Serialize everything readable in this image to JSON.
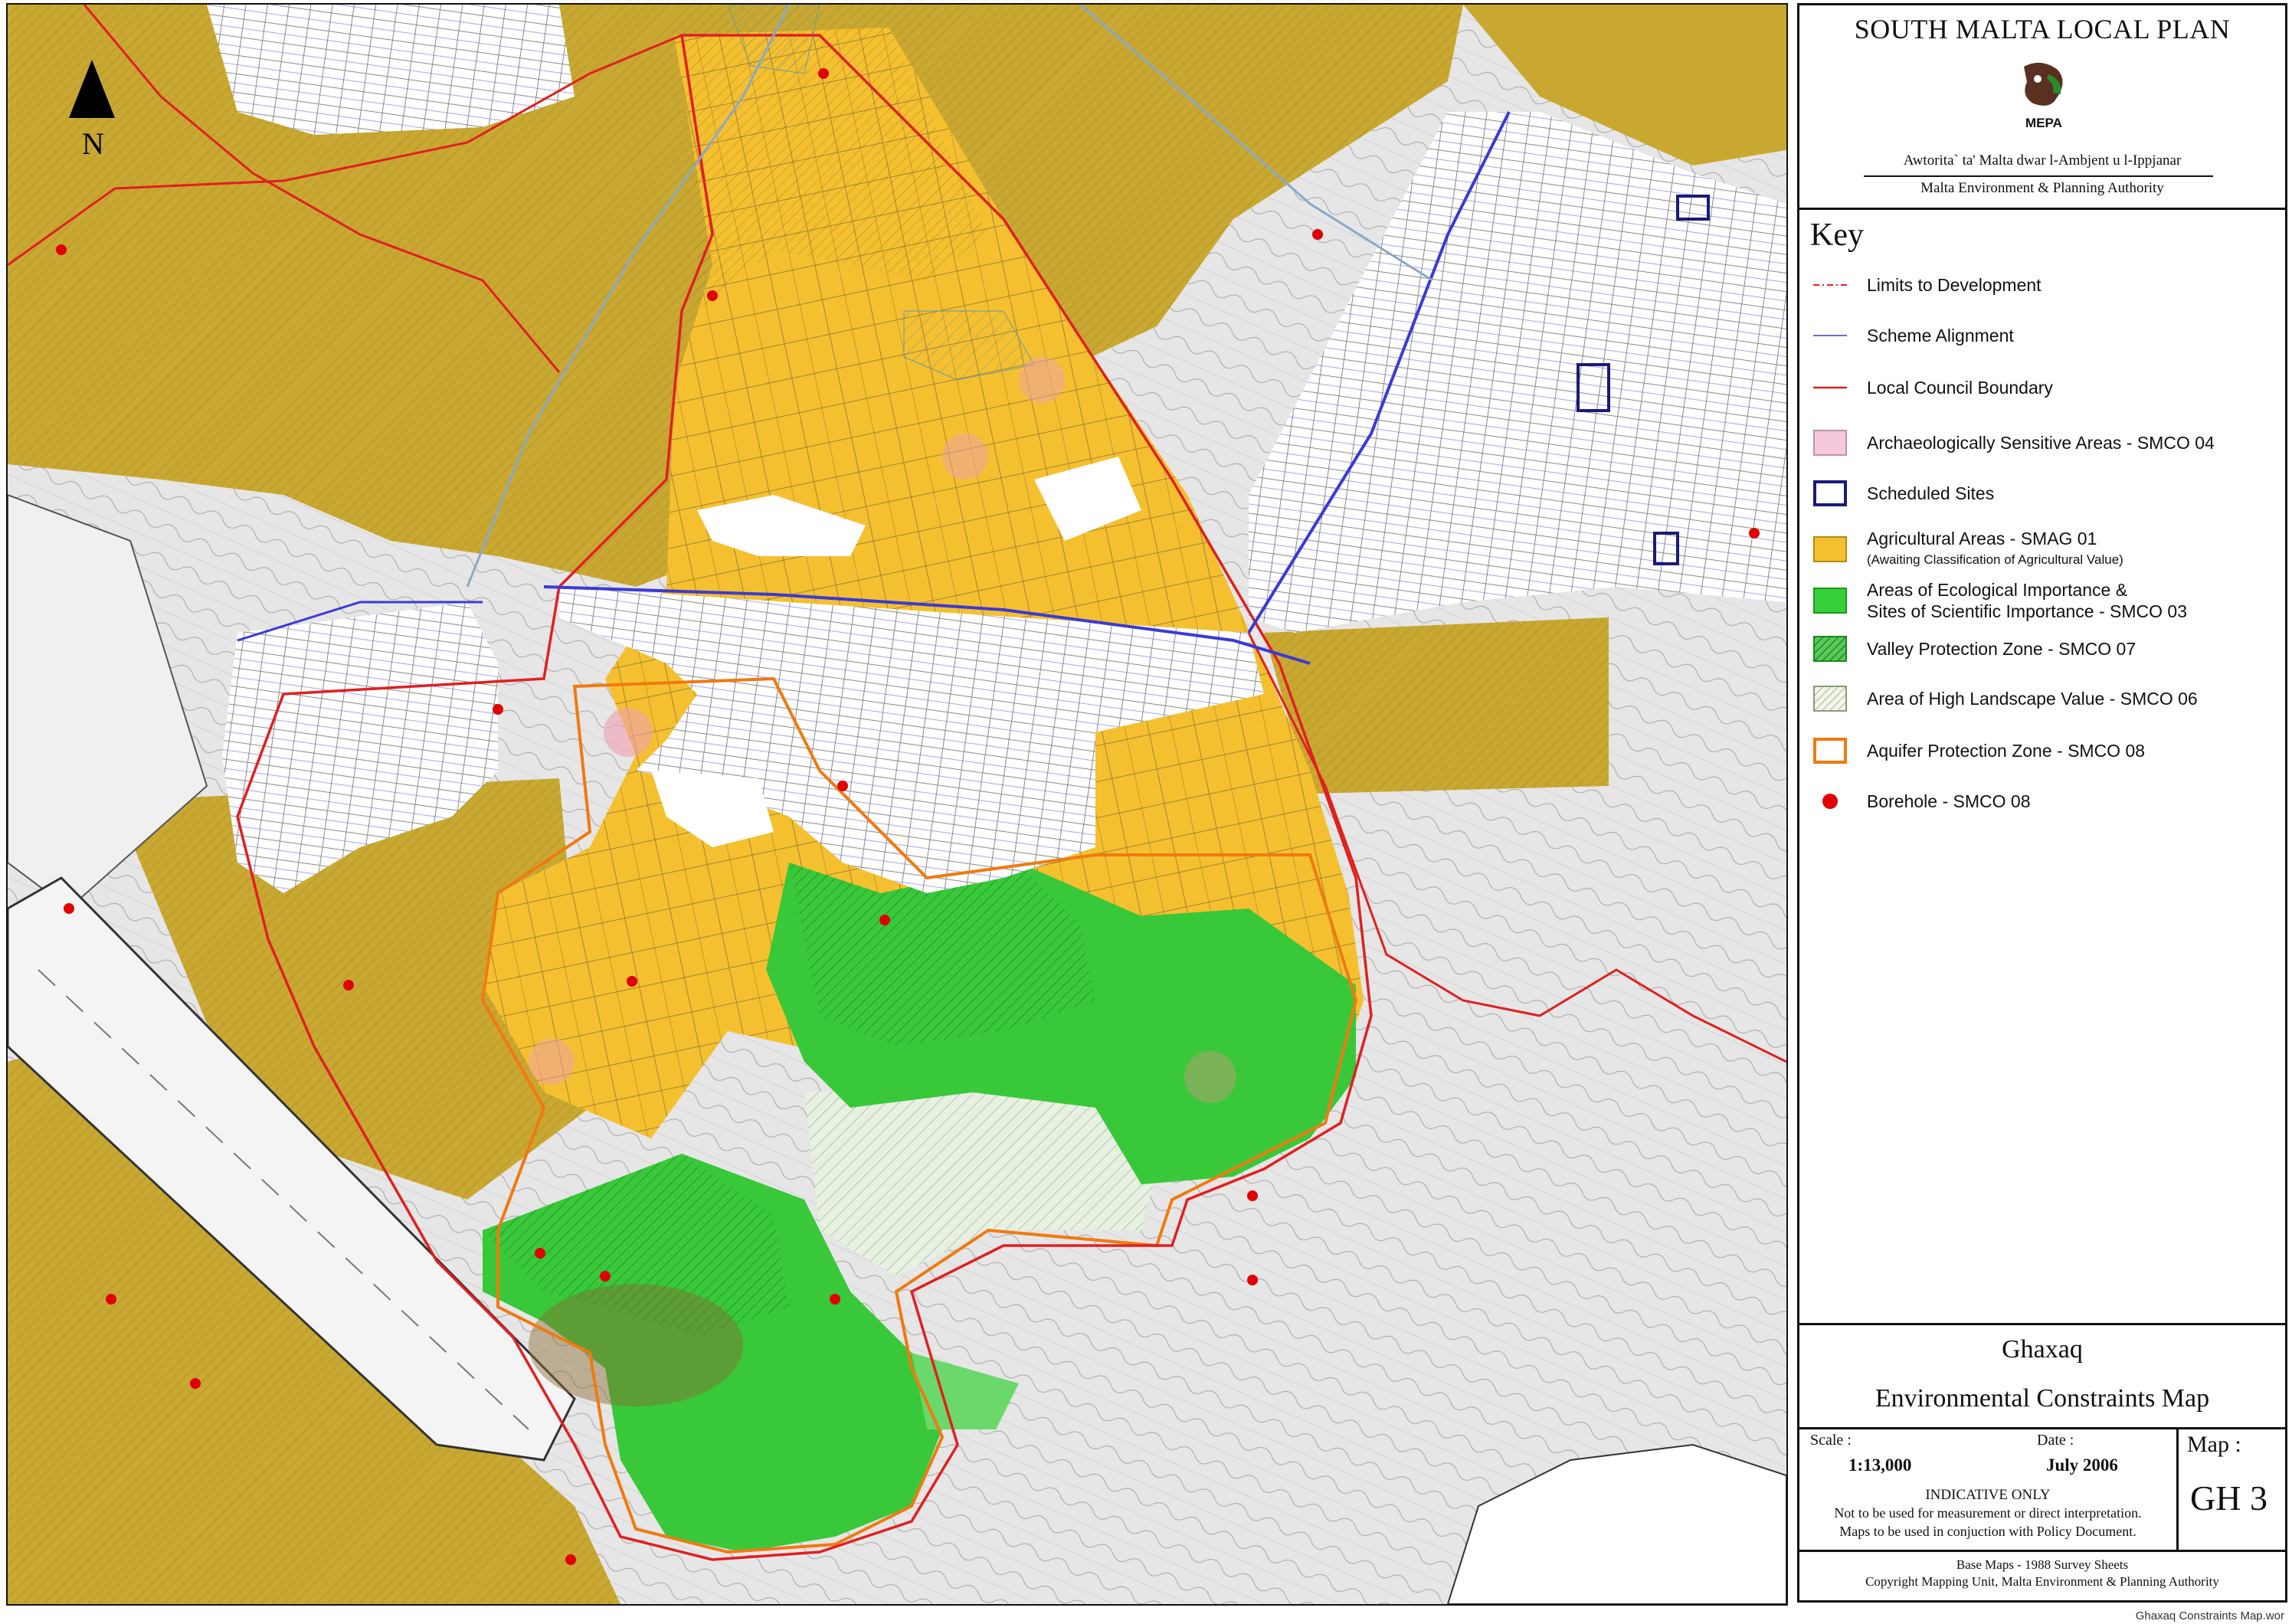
{
  "map": {
    "north_label": "N",
    "colors": {
      "agricultural": "#f5c030",
      "agricultural_outer": "#c9a832",
      "ecological": "#38c83a",
      "valley": "#2ea83a",
      "landscape": "#e8f0e0",
      "urban": "#ffffff",
      "terrain": "#e6e6e6",
      "scheme_alignment": "#3a3ad8",
      "council_boundary": "#e02020",
      "aquifer": "#f07a10",
      "borehole": "#e00000",
      "scheduled": "#1a1a7a"
    }
  },
  "panel": {
    "plan_title": "SOUTH MALTA LOCAL PLAN",
    "logo_text": "MEPA",
    "authority_mt": "Awtorita` ta' Malta dwar l-Ambjent u l-Ippjanar",
    "authority_en": "Malta Environment & Planning Authority",
    "key_title": "Key",
    "legend": [
      {
        "label": "Limits to Development",
        "symbol": "dashdot-line-red"
      },
      {
        "label": "Scheme Alignment",
        "symbol": "line-blue"
      },
      {
        "label": "Local Council Boundary",
        "symbol": "line-red"
      },
      {
        "label": "Archaeologically Sensitive Areas - SMCO 04",
        "symbol": "fill-pink"
      },
      {
        "label": "Scheduled Sites",
        "symbol": "outline-navy"
      },
      {
        "label": "Agricultural Areas - SMAG 01",
        "sub": "(Awaiting Classification of Agricultural Value)",
        "symbol": "fill-yellow"
      },
      {
        "label": "Areas of Ecological Importance &",
        "sub2": "Sites of Scientific Importance - SMCO 03",
        "symbol": "fill-green"
      },
      {
        "label": "Valley Protection Zone - SMCO 07",
        "symbol": "hatch-green"
      },
      {
        "label": "Area of High Landscape Value - SMCO 06",
        "symbol": "hatch-light"
      },
      {
        "label": "Aquifer Protection Zone - SMCO 08",
        "symbol": "outline-orange"
      },
      {
        "label": "Borehole - SMCO 08",
        "symbol": "dot-red"
      }
    ],
    "locality": "Ghaxaq",
    "map_name": "Environmental Constraints Map",
    "scale_label": "Scale :",
    "scale_value": "1:13,000",
    "date_label": "Date :",
    "date_value": "July 2006",
    "indicative": "INDICATIVE ONLY",
    "note1": "Not to be used for measurement or direct interpretation.",
    "note2": "Maps to be used in conjuction with Policy Document.",
    "map_label": "Map :",
    "map_code": "GH 3",
    "base_maps": "Base Maps - 1988 Survey Sheets",
    "copyright": "Copyright Mapping Unit, Malta Environment & Planning Authority"
  },
  "file_name": "Ghaxaq Constraints Map.wor"
}
